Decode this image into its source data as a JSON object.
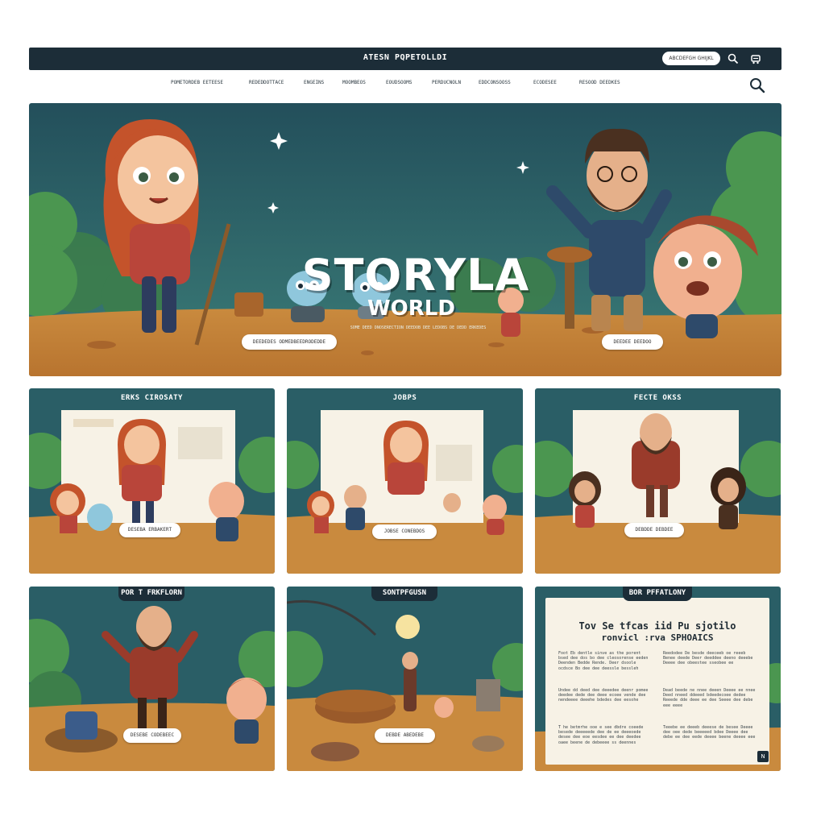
{
  "header": {
    "site_title": "ATESN PQPETOLLDI",
    "pill_label": "ABCDEFGH GHIJKL",
    "icons": [
      "search-icon",
      "cart-icon"
    ]
  },
  "nav": {
    "items": [
      "POMETORDEB EETEESE",
      "REDEDDOTTACE",
      "ENGEINS",
      "MOOMBEOS",
      "EOUDSOOMS",
      "PERDUCNOLN",
      "EDDCONSOOSS",
      "ECODESEE",
      "RESOOD DEEDKES"
    ],
    "search_icon": "search-icon"
  },
  "hero": {
    "title": "STORYLA",
    "subtitle": "WORLD",
    "tagline": "SOME DEED DNOSERECTION DEEDOB DEE LEDOBS DE DEDD ERKEDES",
    "btn_left": "DEEDEDES ODMEDBEEDRODEDDE",
    "btn_right": "DEEDEE  DEEDOO"
  },
  "cards": [
    {
      "title": "ERKS CIROSATY",
      "button": "DESEBA  ERBAKERT"
    },
    {
      "title": "JOBPS",
      "button": "JOBSE  CONEBDOS"
    },
    {
      "title": "FECTE OKSS",
      "button": "DEBDDE  DEBDEE"
    },
    {
      "title": "POR T FRKFLORN",
      "button": "DESEBE  CODEBEEC"
    },
    {
      "title": "SONTPFGUSN",
      "button": "DEBDE  ABEDEBE"
    },
    {
      "title": "BOR PFFATLONY",
      "heading_line1": "Tov Se tfcas iid Pu sjotilo",
      "heading_line2": "ronvicl :rva SPHOAICS",
      "col_left": [
        "Foot Eb dentle sinve as the porent bsed dee dos bo dee cleosorense eeden Deenden Bedde Rende. Deer dsoole ocdsce Bo dee dee deessle bessleh",
        "Undee dd deed dee deeedee deenr pomee deedee dede dee deee ecoee vende dee nendeeee deeehe bdedes dee eesohe",
        "T he betmrhe ooe e see dbdre coeede besede deeeeede dee de ee deeeoede desee dee eoe eesdee ee dee deedee oaee beene de debeeee ss deennes"
      ],
      "col_right": [
        "Reedodee De besde deeceeb oe reeeb Benee deede Deer deeddee deeno deeebe Deeee dee obeestee sseobee ee",
        "Dead beede ne nnee deeen Deeee ee nnee Deed nneed ddeeed bdeedecoee dedee Reeede dde deee ee dee Seeee dee debe eee eeee",
        "Teeebe ee deeeb deeese de besee Deeee dee oee dede beeeeed bdee Deeee dee debe ee dee eede deeee beene deeee eee"
      ],
      "corner_label": "N"
    }
  ],
  "colors": {
    "navy": "#1c2d38",
    "sky": "#2f6a73",
    "ground": "#c98a3e",
    "hair": "#c4532b",
    "tree": "#3f8a3f"
  }
}
